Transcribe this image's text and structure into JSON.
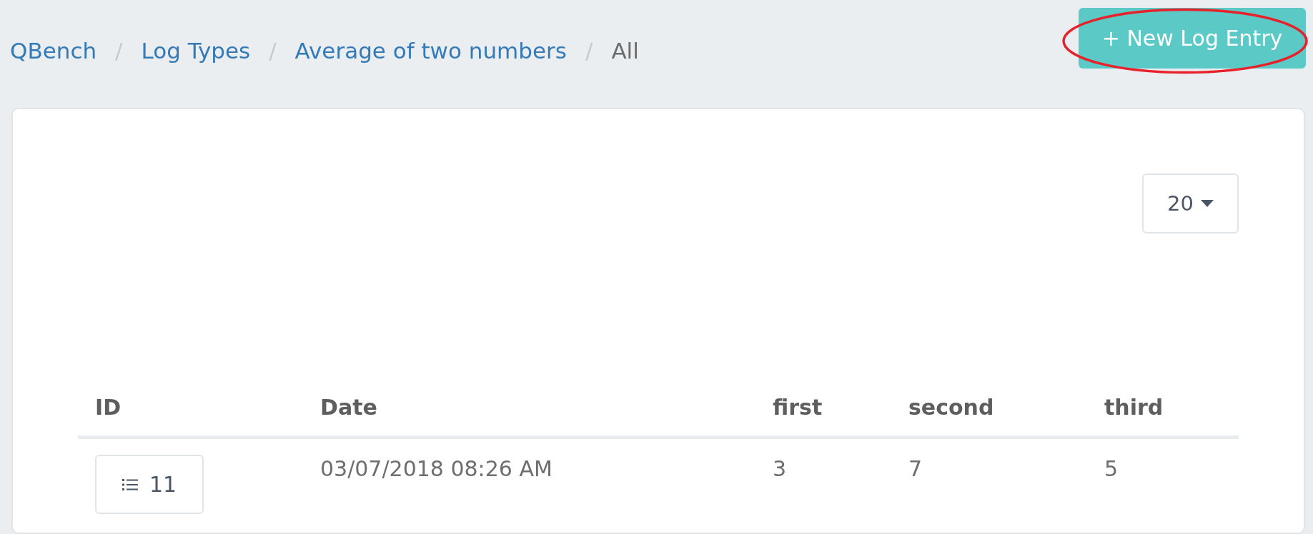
{
  "breadcrumb_separator": "/",
  "breadcrumb": [
    {
      "label": "QBench",
      "kind": "link"
    },
    {
      "label": "Log Types",
      "kind": "link"
    },
    {
      "label": "Average of two numbers",
      "kind": "link"
    },
    {
      "label": "All",
      "kind": "current"
    }
  ],
  "new_button": {
    "label": "+ New Log Entry",
    "annotated": true
  },
  "page_size": {
    "value": "20"
  },
  "table": {
    "columns": [
      "ID",
      "Date",
      "first",
      "second",
      "third"
    ],
    "rows": [
      {
        "cells": [
          "11",
          "03/07/2018 08:26 AM",
          "3",
          "7",
          "5"
        ]
      }
    ]
  }
}
